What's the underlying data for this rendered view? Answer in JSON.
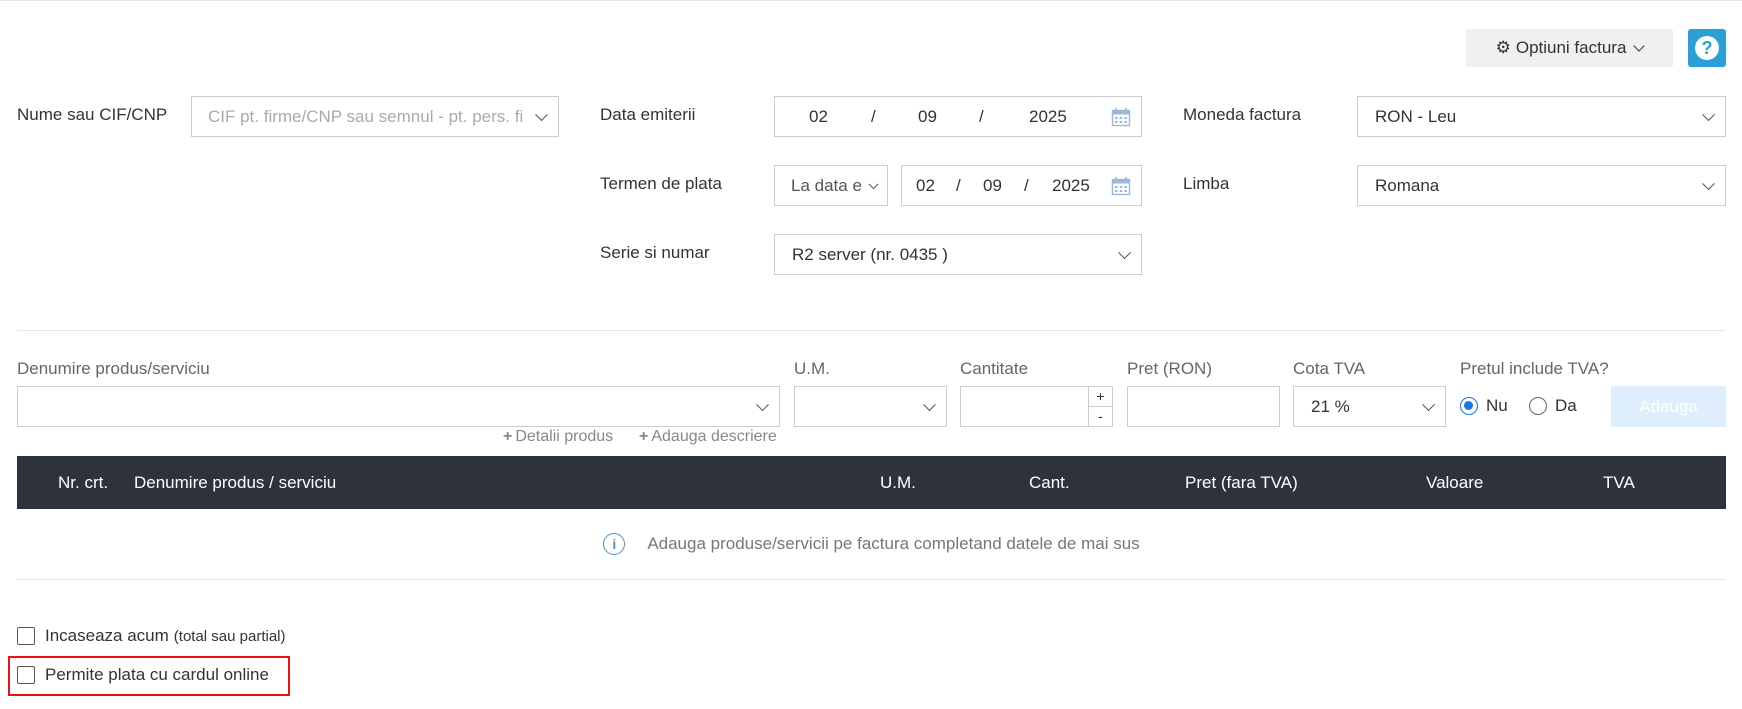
{
  "header": {
    "options_label": "Optiuni factura",
    "help_label": "?"
  },
  "client": {
    "label": "Nume sau CIF/CNP",
    "placeholder": "CIF pt. firme/CNP sau semnul - pt. pers. fizice"
  },
  "issue_date": {
    "label": "Data emiterii",
    "day": "02",
    "month": "09",
    "year": "2025",
    "sep": "/"
  },
  "payment_term": {
    "label": "Termen de plata",
    "select_value": "La data e",
    "day": "02",
    "month": "09",
    "year": "2025",
    "sep": "/"
  },
  "series": {
    "label": "Serie si numar",
    "value": "R2 server (nr. 0435 )"
  },
  "currency": {
    "label": "Moneda factura",
    "value": "RON - Leu"
  },
  "language": {
    "label": "Limba",
    "value": "Romana"
  },
  "product_form": {
    "name_label": "Denumire produs/serviciu",
    "um_label": "U.M.",
    "qty_label": "Cantitate",
    "price_label": "Pret (RON)",
    "vat_label": "Cota TVA",
    "vat_value": "21 %",
    "includes_vat_label": "Pretul include TVA?",
    "option_no": "Nu",
    "option_yes": "Da",
    "add_button": "Adauga",
    "details_link": "Detalii produs",
    "description_link": "Adauga descriere",
    "plus": "+",
    "minus": "-"
  },
  "table": {
    "columns": [
      "Nr. crt.",
      "Denumire produs / serviciu",
      "U.M.",
      "Cant.",
      "Pret (fara TVA)",
      "Valoare",
      "TVA"
    ],
    "empty_message": "Adauga produse/servicii pe factura completand datele de mai sus"
  },
  "options": {
    "collect_now": "Incaseaza acum",
    "collect_now_sub": "(total sau partial)",
    "card_payment": "Permite plata cu cardul online"
  }
}
